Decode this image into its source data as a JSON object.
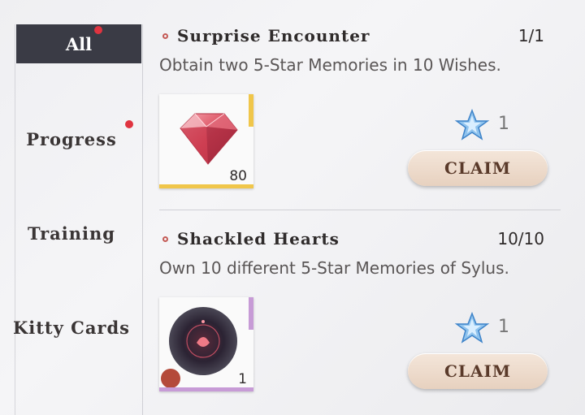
{
  "sidebar": {
    "tabs": [
      {
        "label": "All",
        "active": true,
        "badge": true
      },
      {
        "label": "Progress",
        "active": false,
        "badge": true
      },
      {
        "label": "Training",
        "active": false,
        "badge": false
      },
      {
        "label": "Kitty Cards",
        "active": false,
        "badge": false
      }
    ]
  },
  "tasks": [
    {
      "title": "Surprise Encounter",
      "progress": "1/1",
      "description": "Obtain two 5-Star Memories in 10 Wishes.",
      "item": {
        "icon": "red-diamond-icon",
        "quantity": "80",
        "accent": "#f0c64a"
      },
      "reward": {
        "icon": "blue-star-icon",
        "count": "1"
      },
      "claim_label": "CLAIM"
    },
    {
      "title": "Shackled Hearts",
      "progress": "10/10",
      "description": "Own 10 different 5-Star Memories of Sylus.",
      "item": {
        "icon": "dark-orb-icon",
        "quantity": "1",
        "accent": "#c79bd6"
      },
      "reward": {
        "icon": "blue-star-icon",
        "count": "1"
      },
      "claim_label": "CLAIM"
    }
  ]
}
